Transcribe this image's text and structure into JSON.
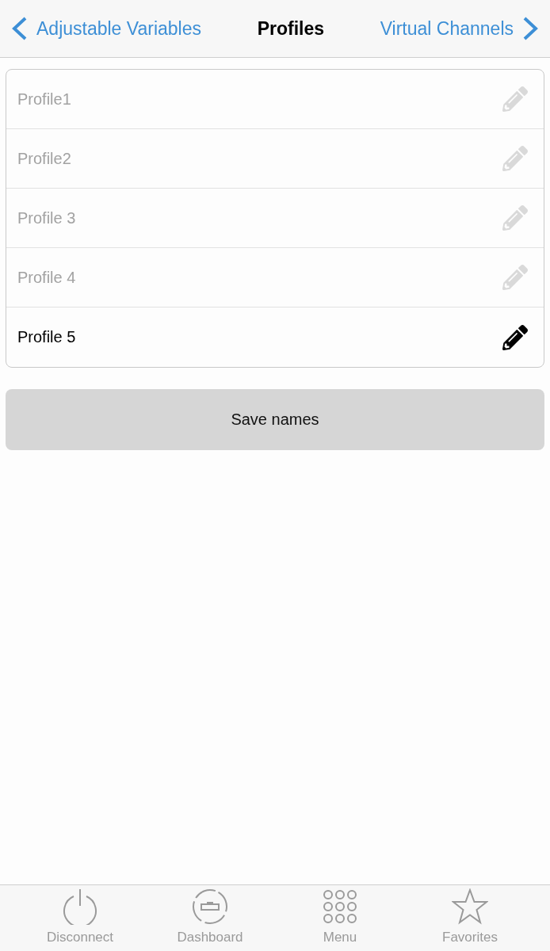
{
  "nav": {
    "back": "Adjustable Variables",
    "title": "Profiles",
    "forward": "Virtual Channels"
  },
  "profiles": [
    {
      "name": "Profile1",
      "selected": false
    },
    {
      "name": "Profile2",
      "selected": false
    },
    {
      "name": "Profile 3",
      "selected": false
    },
    {
      "name": "Profile 4",
      "selected": false
    },
    {
      "name": "Profile 5",
      "selected": true
    }
  ],
  "save_button": "Save names",
  "tab_bar": [
    {
      "label": "Disconnect",
      "kind": "power"
    },
    {
      "label": "Dashboard",
      "kind": "dashboard"
    },
    {
      "label": "Menu",
      "kind": "grid"
    },
    {
      "label": "Favorites",
      "kind": "star"
    }
  ]
}
